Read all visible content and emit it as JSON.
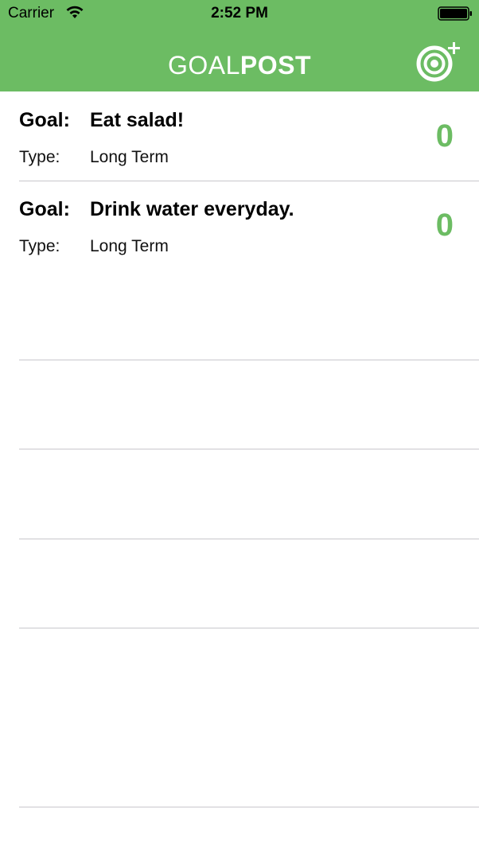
{
  "status_bar": {
    "carrier": "Carrier",
    "time": "2:52 PM"
  },
  "nav": {
    "title_light": "GOAL",
    "title_bold": "POST",
    "add_icon": "target-plus-icon"
  },
  "colors": {
    "brand_green": "#6cbc63",
    "separator": "#c8c7cc"
  },
  "goals": [
    {
      "goal_label": "Goal:",
      "goal": "Eat salad!",
      "type_label": "Type:",
      "type": "Long Term",
      "progress": "0"
    },
    {
      "goal_label": "Goal:",
      "goal": "Drink water everyday.",
      "type_label": "Type:",
      "type": "Long Term",
      "progress": "0"
    }
  ]
}
